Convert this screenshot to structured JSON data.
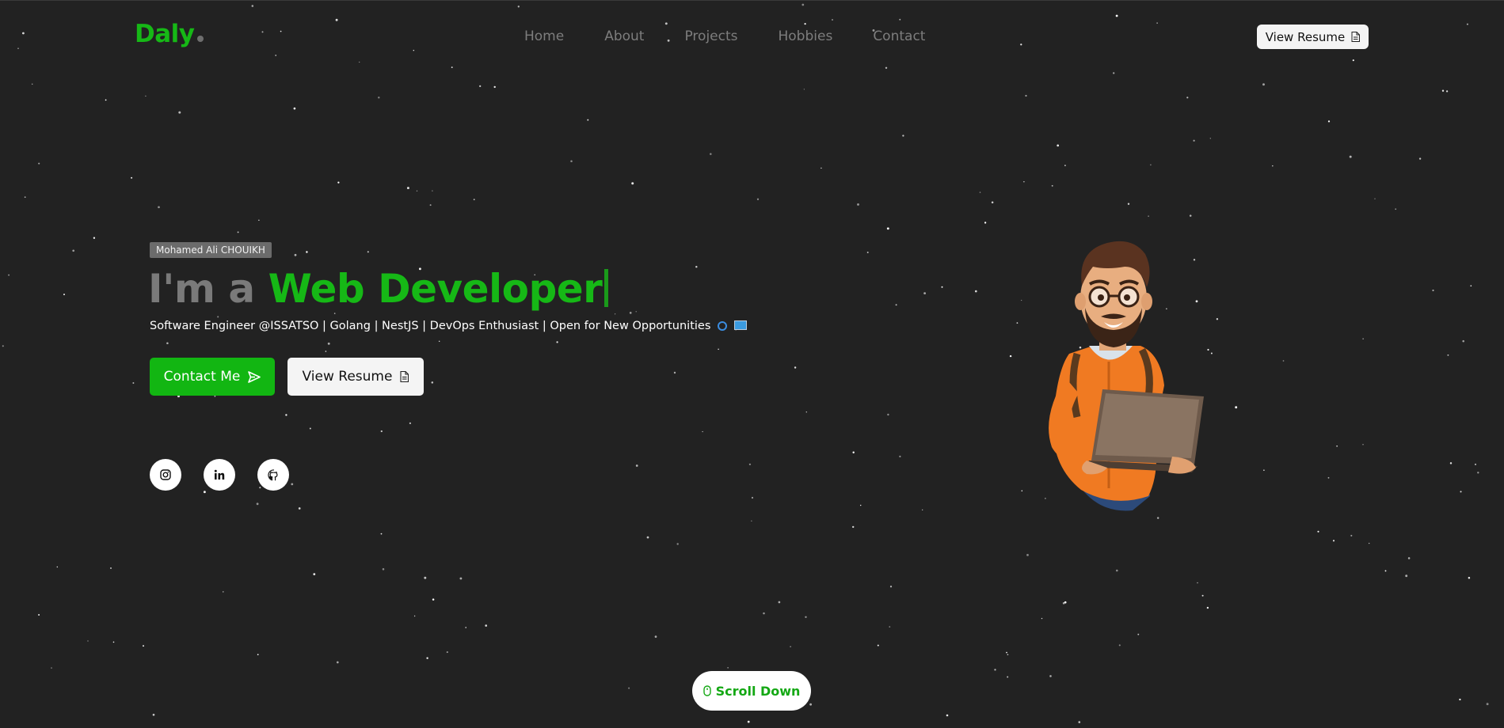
{
  "nav": {
    "logo": "Daly",
    "items": [
      {
        "label": "Home"
      },
      {
        "label": "About"
      },
      {
        "label": "Projects"
      },
      {
        "label": "Hobbies"
      },
      {
        "label": "Contact"
      }
    ],
    "resume_button": "View Resume"
  },
  "hero": {
    "badge": "Mohamed Ali CHOUIKH",
    "headline_prefix": "I'm a",
    "headline_role": "Web Developer",
    "subtitle": "Software Engineer @ISSATSO | Golang | NestJS | DevOps Enthusiast | Open for New Opportunities",
    "contact_button": "Contact Me",
    "resume_button": "View Resume",
    "socials": [
      {
        "icon": "instagram-icon"
      },
      {
        "icon": "linkedin-icon"
      },
      {
        "icon": "github-icon"
      }
    ]
  },
  "scroll": {
    "label": "Scroll Down"
  },
  "colors": {
    "accent": "#16b816",
    "background": "#222222",
    "muted": "#7a7a7a"
  }
}
